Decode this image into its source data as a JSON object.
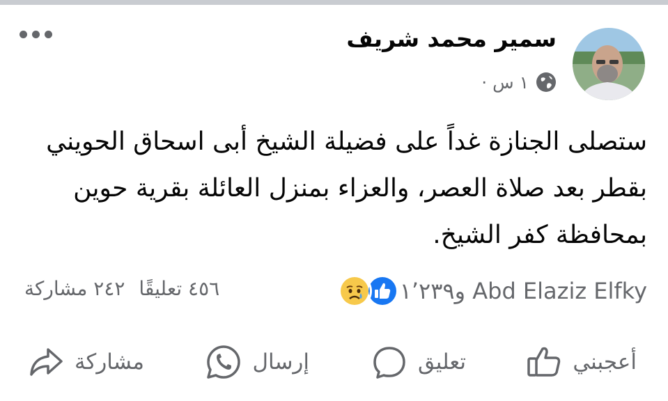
{
  "post": {
    "author": "سمير محمد شريف",
    "time": "١ س ·",
    "audience_icon": "globe-icon",
    "more_icon": "more-dots-icon",
    "text": "ستصلى الجنازة غداً على فضيلة الشيخ أبى اسحاق الحويني بقطر بعد صلاة العصر، والعزاء بمنزل العائلة بقرية حوين بمحافظة كفر الشيخ."
  },
  "stats": {
    "reactions_text": "Abd Elaziz Elfky و١٬٢٣٩",
    "reaction_icons": [
      "like-reaction-icon",
      "sad-reaction-icon"
    ],
    "comments": "٤٥٦ تعليقًا",
    "shares": "٢٤٢ مشاركة"
  },
  "actions": {
    "like": "أعجبني",
    "comment": "تعليق",
    "send": "إرسال",
    "share": "مشاركة"
  },
  "colors": {
    "like_blue": "#1877f2",
    "sad_yellow": "#f7c94b",
    "secondary_text": "#65676b"
  }
}
